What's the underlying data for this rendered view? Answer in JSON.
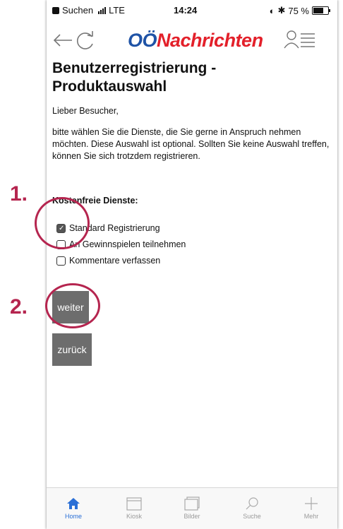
{
  "status_bar": {
    "back_app": "Suchen",
    "network": "LTE",
    "time": "14:24",
    "battery": "75 %",
    "battery_level": 0.75
  },
  "header": {
    "logo_oo": "OÖ",
    "logo_rest": "Nachrichten"
  },
  "content": {
    "title": "Benutzerregistrierung - Produktauswahl",
    "greeting": "Lieber Besucher,",
    "intro": "bitte wählen Sie die Dienste, die Sie gerne in Anspruch nehmen möchten. Diese Auswahl ist optional. Sollten Sie keine Auswahl treffen, können Sie sich trotzdem registrieren.",
    "section_heading": "Kostenfreie Dienste:",
    "options": [
      {
        "label": "Standard Registrierung",
        "checked": true
      },
      {
        "label": "An Gewinnspielen teilnehmen",
        "checked": false
      },
      {
        "label": "Kommentare verfassen",
        "checked": false
      }
    ],
    "next_button": "weiter",
    "back_button": "zurück"
  },
  "tab_bar": {
    "tabs": [
      {
        "label": "Home",
        "icon": "home-icon",
        "active": true
      },
      {
        "label": "Kiosk",
        "icon": "kiosk-icon",
        "active": false
      },
      {
        "label": "Bilder",
        "icon": "pictures-icon",
        "active": false
      },
      {
        "label": "Suche",
        "icon": "search-icon",
        "active": false
      },
      {
        "label": "Mehr",
        "icon": "plus-icon",
        "active": false
      }
    ],
    "active_color": "#2a6fd6"
  },
  "annotations": {
    "step1": "1.",
    "step2": "2.",
    "color": "#b5254f"
  },
  "colors": {
    "logo_blue": "#1f53a6",
    "logo_red": "#e3202a",
    "button_gray": "#6d6d6d"
  }
}
